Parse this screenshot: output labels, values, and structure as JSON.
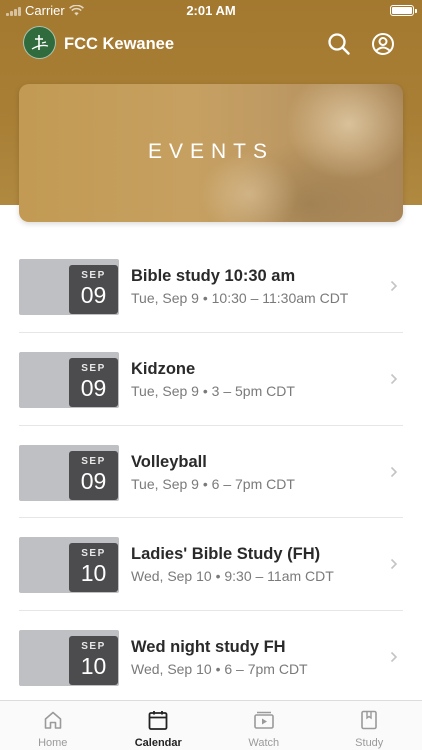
{
  "status_bar": {
    "carrier": "Carrier",
    "time": "2:01 AM"
  },
  "header": {
    "title": "FCC Kewanee",
    "icons": [
      "search-icon",
      "profile-icon"
    ]
  },
  "banner": {
    "title": "EVENTS"
  },
  "events": [
    {
      "month": "SEP",
      "day": "09",
      "title": "Bible study 10:30 am",
      "subtitle": "Tue, Sep 9 • 10:30 – 11:30am CDT"
    },
    {
      "month": "SEP",
      "day": "09",
      "title": "Kidzone",
      "subtitle": "Tue, Sep 9 • 3 – 5pm CDT"
    },
    {
      "month": "SEP",
      "day": "09",
      "title": "Volleyball",
      "subtitle": "Tue, Sep 9 • 6 – 7pm CDT"
    },
    {
      "month": "SEP",
      "day": "10",
      "title": "Ladies' Bible Study (FH)",
      "subtitle": "Wed, Sep 10 • 9:30 – 11am CDT"
    },
    {
      "month": "SEP",
      "day": "10",
      "title": "Wed night study FH",
      "subtitle": "Wed, Sep 10 • 6 – 7pm CDT"
    }
  ],
  "tabs": [
    {
      "label": "Home",
      "icon": "home-icon",
      "active": false
    },
    {
      "label": "Calendar",
      "icon": "calendar-icon",
      "active": true
    },
    {
      "label": "Watch",
      "icon": "watch-icon",
      "active": false
    },
    {
      "label": "Study",
      "icon": "study-icon",
      "active": false
    }
  ],
  "colors": {
    "header": "#a97f36",
    "logo": "#2f6b3c",
    "date_box": "#4c4c4e",
    "thumb": "#bfc0c4"
  }
}
